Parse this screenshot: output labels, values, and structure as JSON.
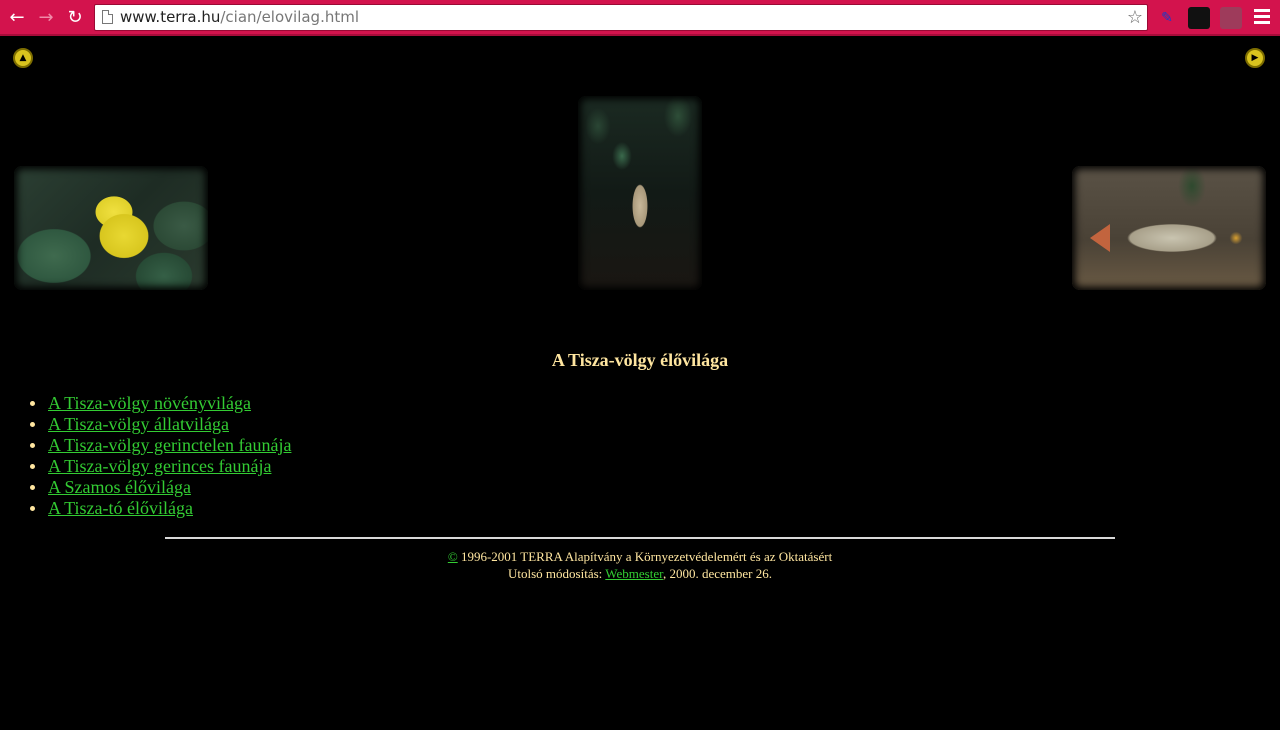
{
  "browser": {
    "back_glyph": "←",
    "forward_glyph": "→",
    "reload_glyph": "↻",
    "url_host": "www.terra.hu",
    "url_path": "/cian/elovilag.html",
    "star_glyph": "☆",
    "ext1_glyph": "✎",
    "ext2_glyph": "◼◼",
    "ext3_glyph": "◼◼"
  },
  "page": {
    "up_arrow_glyph": "▲",
    "next_arrow_glyph": "▶",
    "title": "A Tisza-völgy élővilága",
    "links": [
      {
        "label": "A Tisza-völgy növényvilága"
      },
      {
        "label": "A Tisza-völgy állatvilága"
      },
      {
        "label": "A Tisza-völgy gerinctelen faunája"
      },
      {
        "label": "A Tisza-völgy gerinces faunája"
      },
      {
        "label": "A Szamos élővilága"
      },
      {
        "label": "A Tisza-tó élővilága"
      }
    ],
    "footer": {
      "copyright_symbol": "©",
      "copyright_text": " 1996-2001 TERRA Alapítvány a Környezetvédelemért és az Oktatásért",
      "modified_prefix": "Utolsó módosítás: ",
      "webmaster_label": "Webmester",
      "modified_suffix": ", 2000. december 26."
    }
  },
  "colors": {
    "chrome": "#d3134d",
    "background": "#000000",
    "text": "#ffe6a0",
    "link": "#33cc33"
  }
}
